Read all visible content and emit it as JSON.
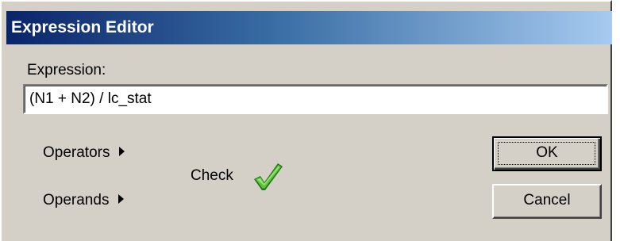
{
  "window": {
    "title": "Expression Editor"
  },
  "expression": {
    "label": "Expression:",
    "value": "(N1 + N2) / lc_stat"
  },
  "menus": {
    "operators_label": "Operators",
    "operands_label": "Operands"
  },
  "check": {
    "label": "Check",
    "icon": "checkmark-icon",
    "color": "#2e8b1e"
  },
  "buttons": {
    "ok_label": "OK",
    "cancel_label": "Cancel"
  },
  "colors": {
    "title_start": "#0a246a",
    "title_end": "#a6caf0",
    "face": "#d4d0c8"
  }
}
